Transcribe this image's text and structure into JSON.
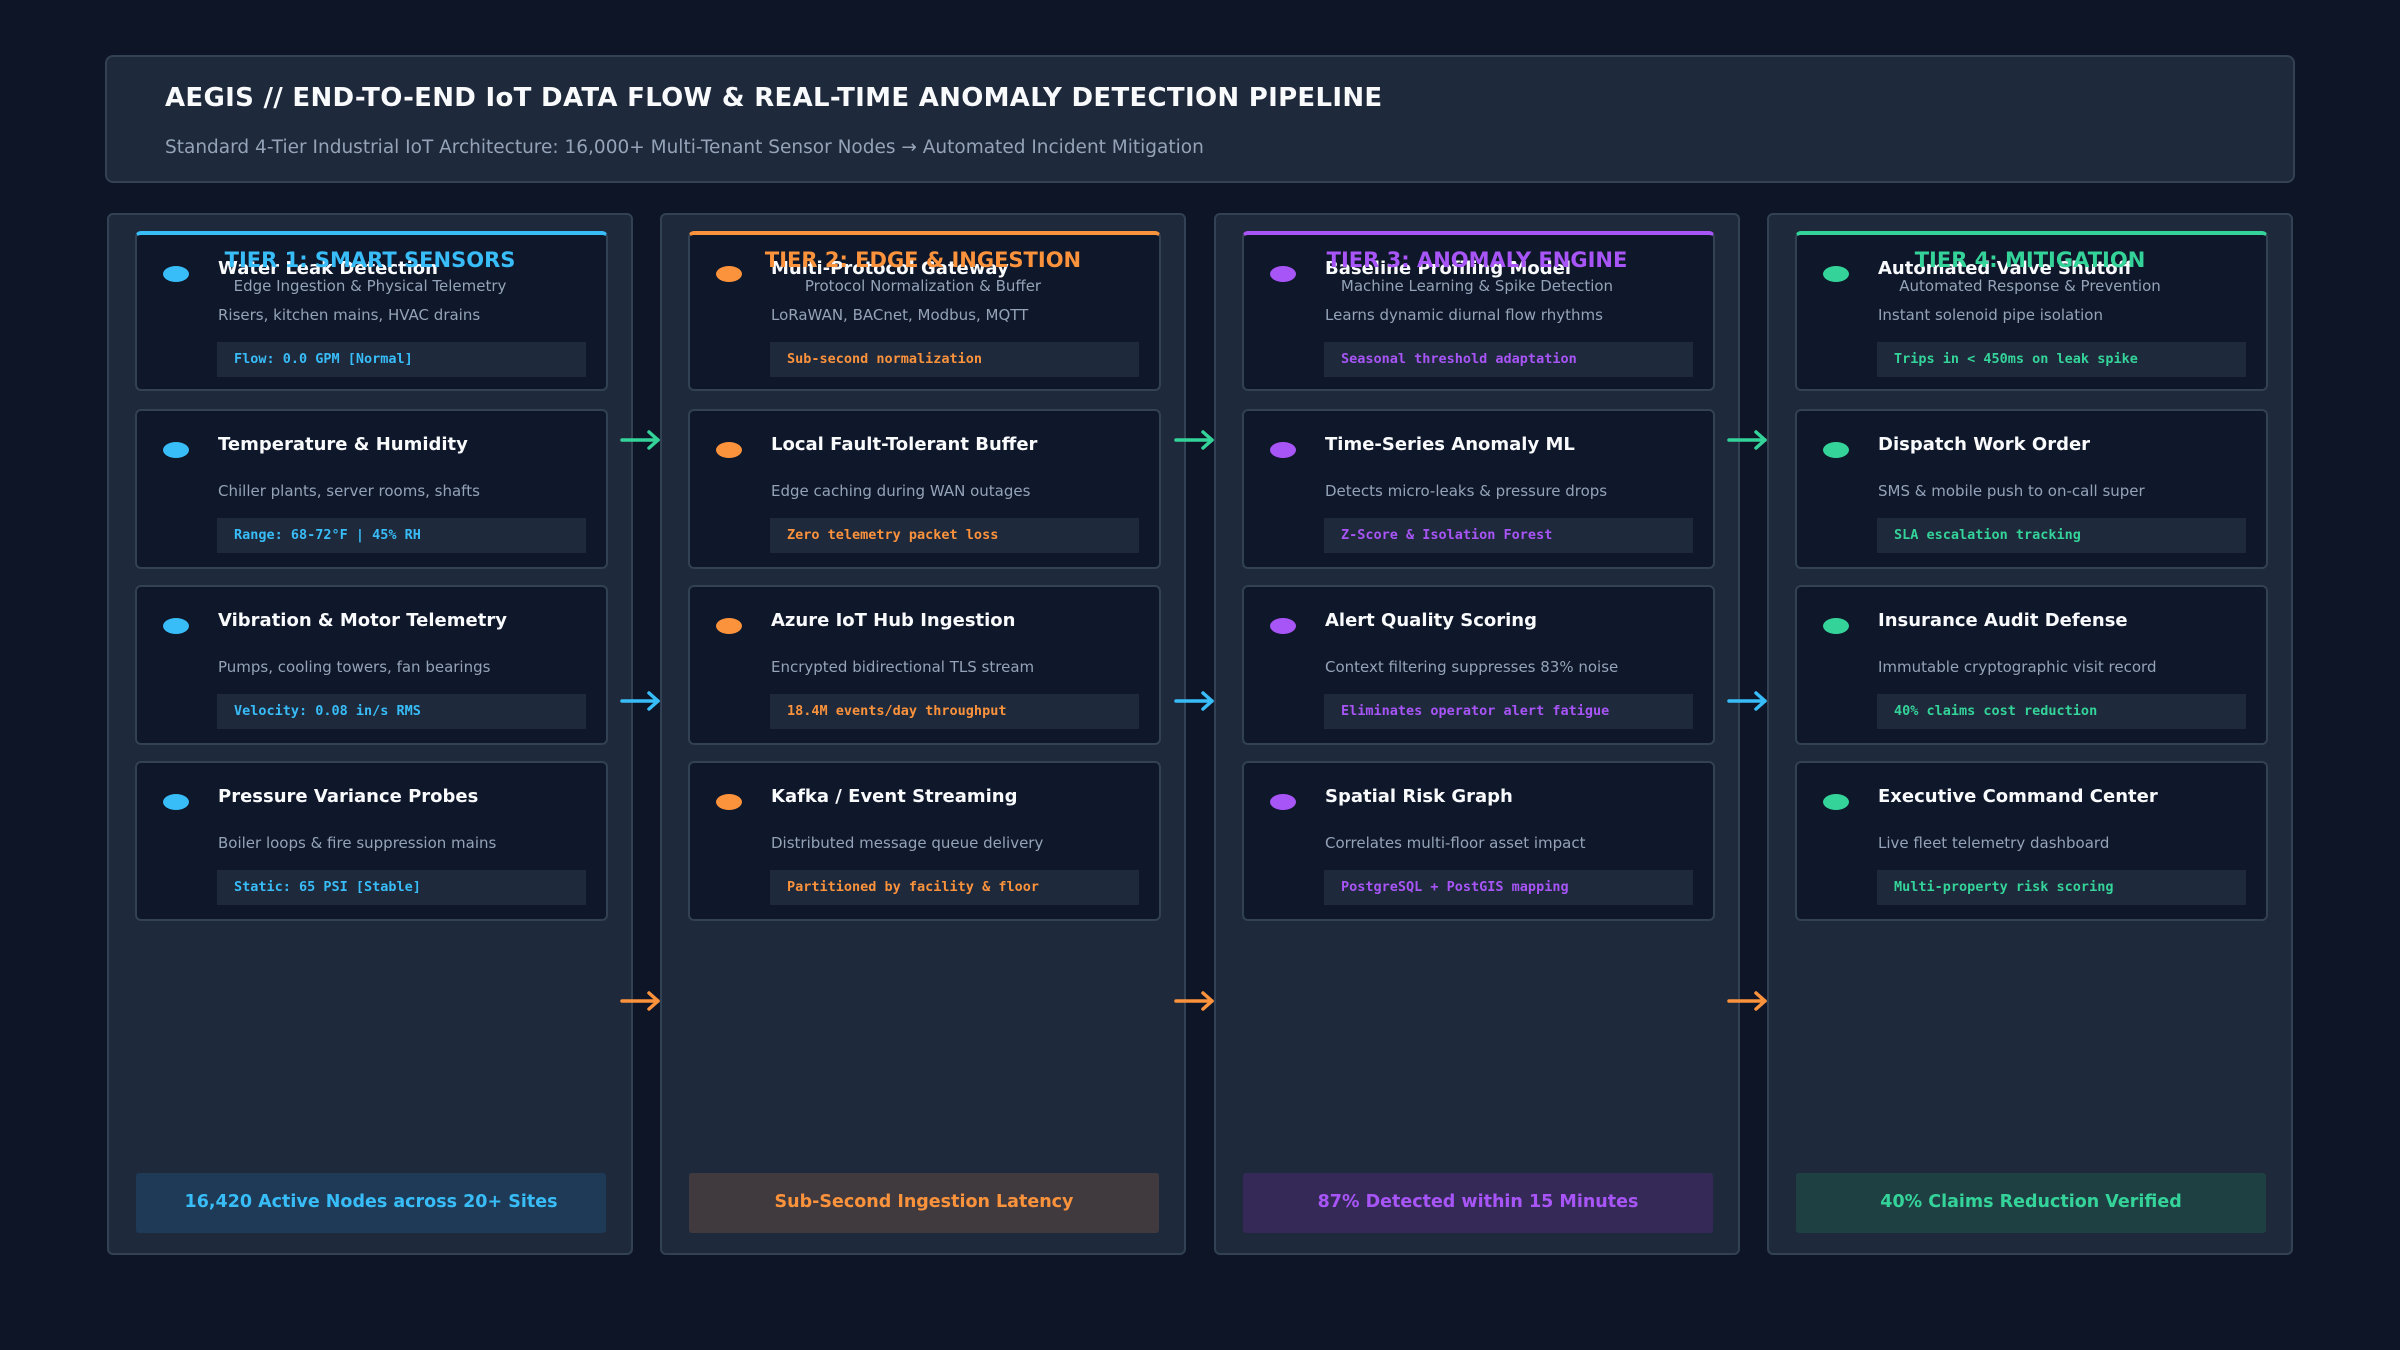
{
  "header": {
    "title": "AEGIS // END-TO-END IoT DATA FLOW & REAL-TIME ANOMALY DETECTION PIPELINE",
    "subtitle": "Standard 4-Tier Industrial IoT Architecture: 16,000+ Multi-Tenant Sensor Nodes → Automated Incident Mitigation"
  },
  "tiers": [
    {
      "title": "TIER 1: SMART SENSORS",
      "subtitle": "Edge Ingestion & Physical Telemetry",
      "accent": "#38bdf8",
      "footer_bg": "#1e3a56",
      "cards": [
        {
          "title": "Water Leak Detection",
          "desc": "Risers, kitchen mains, HVAC drains",
          "badge": "Flow: 0.0 GPM [Normal]"
        },
        {
          "title": "Temperature & Humidity",
          "desc": "Chiller plants, server rooms, shafts",
          "badge": "Range: 68-72°F | 45% RH"
        },
        {
          "title": "Vibration & Motor Telemetry",
          "desc": "Pumps, cooling towers, fan bearings",
          "badge": "Velocity: 0.08 in/s RMS"
        },
        {
          "title": "Pressure Variance Probes",
          "desc": "Boiler loops & fire suppression mains",
          "badge": "Static: 65 PSI [Stable]"
        }
      ],
      "footer": "16,420 Active Nodes across 20+ Sites"
    },
    {
      "title": "TIER 2: EDGE & INGESTION",
      "subtitle": "Protocol Normalization & Buffer",
      "accent": "#fb923c",
      "footer_bg": "#403a3e",
      "cards": [
        {
          "title": "Multi-Protocol Gateway",
          "desc": "LoRaWAN, BACnet, Modbus, MQTT",
          "badge": "Sub-second normalization"
        },
        {
          "title": "Local Fault-Tolerant Buffer",
          "desc": "Edge caching during WAN outages",
          "badge": "Zero telemetry packet loss"
        },
        {
          "title": "Azure IoT Hub Ingestion",
          "desc": "Encrypted bidirectional TLS stream",
          "badge": "18.4M events/day throughput"
        },
        {
          "title": "Kafka / Event Streaming",
          "desc": "Distributed message queue delivery",
          "badge": "Partitioned by facility & floor"
        }
      ],
      "footer": "Sub-Second Ingestion Latency"
    },
    {
      "title": "TIER 3: ANOMALY ENGINE",
      "subtitle": "Machine Learning & Spike Detection",
      "accent": "#a855f7",
      "footer_bg": "#352a57",
      "cards": [
        {
          "title": "Baseline Profiling Model",
          "desc": "Learns dynamic diurnal flow rhythms",
          "badge": "Seasonal threshold adaptation"
        },
        {
          "title": "Time-Series Anomaly ML",
          "desc": "Detects micro-leaks & pressure drops",
          "badge": "Z-Score & Isolation Forest"
        },
        {
          "title": "Alert Quality Scoring",
          "desc": "Context filtering suppresses 83% noise",
          "badge": "Eliminates operator alert fatigue"
        },
        {
          "title": "Spatial Risk Graph",
          "desc": "Correlates multi-floor asset impact",
          "badge": "PostgreSQL + PostGIS mapping"
        }
      ],
      "footer": "87% Detected within 15 Minutes"
    },
    {
      "title": "TIER 4: MITIGATION",
      "subtitle": "Automated Response & Prevention",
      "accent": "#34d399",
      "footer_bg": "#1e4043",
      "cards": [
        {
          "title": "Automated Valve Shutoff",
          "desc": "Instant solenoid pipe isolation",
          "badge": "Trips in < 450ms on leak spike"
        },
        {
          "title": "Dispatch Work Order",
          "desc": "SMS & mobile push to on-call super",
          "badge": "SLA escalation tracking"
        },
        {
          "title": "Insurance Audit Defense",
          "desc": "Immutable cryptographic visit record",
          "badge": "40% claims cost reduction"
        },
        {
          "title": "Executive Command Center",
          "desc": "Live fleet telemetry dashboard",
          "badge": "Multi-property risk scoring"
        }
      ],
      "footer": "40% Claims Reduction Verified"
    }
  ],
  "connector_colors": [
    "#34d399",
    "#38bdf8",
    "#fb923c"
  ]
}
